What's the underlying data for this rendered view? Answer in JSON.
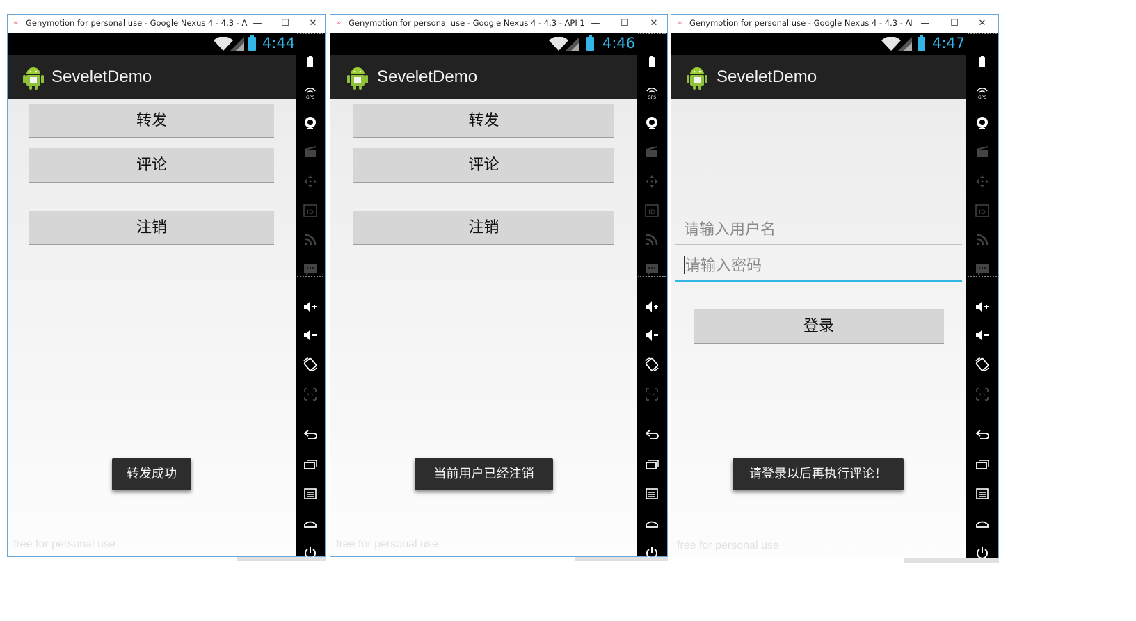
{
  "windows": [
    {
      "title": "Genymotion for personal use - Google Nexus 4 - 4.3 - API 1...",
      "time": "4:44",
      "app_title": "SeveletDemo",
      "buttons": [
        "转发",
        "评论",
        "注销"
      ],
      "toast": "转发成功",
      "watermark": "free for personal use"
    },
    {
      "title": "Genymotion for personal use - Google Nexus 4 - 4.3 - API 1...",
      "time": "4:46",
      "app_title": "SeveletDemo",
      "buttons": [
        "转发",
        "评论",
        "注销"
      ],
      "toast": "当前用户已经注销",
      "watermark": "free for personal use"
    },
    {
      "title": "Genymotion for personal use - Google Nexus 4 - 4.3 - API 1...",
      "time": "4:47",
      "app_title": "SeveletDemo",
      "username_placeholder": "请输入用户名",
      "password_placeholder": "请输入密码",
      "login_button": "登录",
      "toast": "请登录以后再执行评论！",
      "watermark": "free for personal use"
    }
  ],
  "window_controls": {
    "minimize": "—",
    "maximize": "☐",
    "close": "✕"
  },
  "sidebar_icons": [
    "battery-icon",
    "gps-icon",
    "camera-icon",
    "capture-icon",
    "dpad-icon",
    "id-icon",
    "rss-icon",
    "sms-icon",
    "volume-up-icon",
    "volume-down-icon",
    "rotate-icon",
    "pixel-perfect-icon",
    "back-icon",
    "recent-apps-icon",
    "menu-icon",
    "home-icon",
    "power-icon"
  ],
  "colors": {
    "accent": "#33b5e5",
    "action_bar": "#222222",
    "status_bar": "#000000",
    "toast": "#2d2d2d",
    "button": "#d6d6d6"
  }
}
